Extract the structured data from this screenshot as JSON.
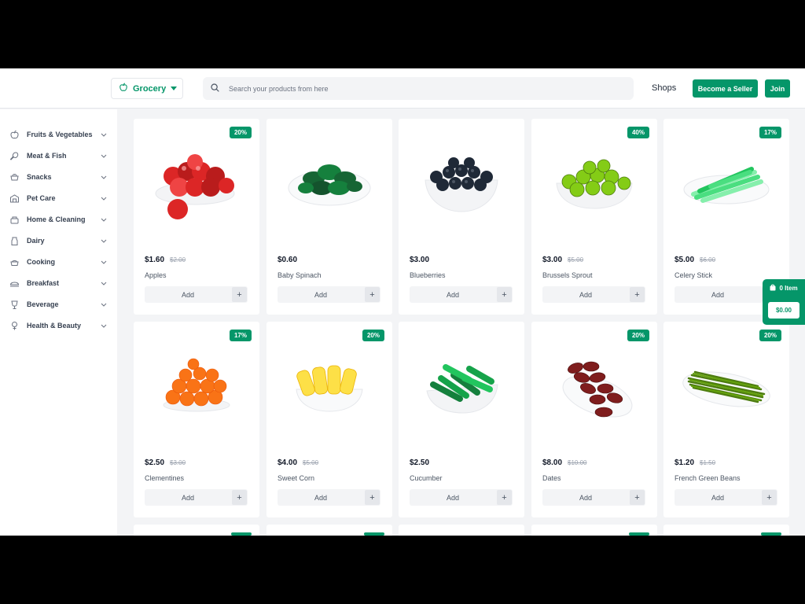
{
  "header": {
    "category_button": "Grocery",
    "search_placeholder": "Search your products from here",
    "shops_link": "Shops",
    "become_seller": "Become a Seller",
    "join": "Join"
  },
  "sidebar": {
    "items": [
      {
        "label": "Fruits & Vegetables",
        "icon": "apple-icon"
      },
      {
        "label": "Meat & Fish",
        "icon": "meat-icon"
      },
      {
        "label": "Snacks",
        "icon": "snack-icon"
      },
      {
        "label": "Pet Care",
        "icon": "pet-care-icon"
      },
      {
        "label": "Home & Cleaning",
        "icon": "cleaning-icon"
      },
      {
        "label": "Dairy",
        "icon": "dairy-icon"
      },
      {
        "label": "Cooking",
        "icon": "cooking-pot-icon"
      },
      {
        "label": "Breakfast",
        "icon": "breakfast-icon"
      },
      {
        "label": "Beverage",
        "icon": "beverage-icon"
      },
      {
        "label": "Health & Beauty",
        "icon": "health-beauty-icon"
      }
    ]
  },
  "products": [
    {
      "name": "Apples",
      "price": "$1.60",
      "old_price": "$2.00",
      "badge": "20%",
      "add": "Add",
      "image": "apples"
    },
    {
      "name": "Baby Spinach",
      "price": "$0.60",
      "old_price": "",
      "badge": "",
      "add": "Add",
      "image": "spinach"
    },
    {
      "name": "Blueberries",
      "price": "$3.00",
      "old_price": "",
      "badge": "",
      "add": "Add",
      "image": "berries"
    },
    {
      "name": "Brussels Sprout",
      "price": "$3.00",
      "old_price": "$5.00",
      "badge": "40%",
      "add": "Add",
      "image": "sprouts"
    },
    {
      "name": "Celery Stick",
      "price": "$5.00",
      "old_price": "$6.00",
      "badge": "17%",
      "add": "Add",
      "image": "celery"
    },
    {
      "name": "Clementines",
      "price": "$2.50",
      "old_price": "$3.00",
      "badge": "17%",
      "add": "Add",
      "image": "clementines"
    },
    {
      "name": "Sweet Corn",
      "price": "$4.00",
      "old_price": "$5.00",
      "badge": "20%",
      "add": "Add",
      "image": "corn"
    },
    {
      "name": "Cucumber",
      "price": "$2.50",
      "old_price": "",
      "badge": "",
      "add": "Add",
      "image": "cucumber"
    },
    {
      "name": "Dates",
      "price": "$8.00",
      "old_price": "$10.00",
      "badge": "20%",
      "add": "Add",
      "image": "dates"
    },
    {
      "name": "French Green Beans",
      "price": "$1.20",
      "old_price": "$1.50",
      "badge": "20%",
      "add": "Add",
      "image": "beans"
    }
  ],
  "cart": {
    "count": "0 Item",
    "total": "$0.00"
  },
  "colors": {
    "accent": "#059669",
    "page_bg": "#f3f4f6"
  }
}
